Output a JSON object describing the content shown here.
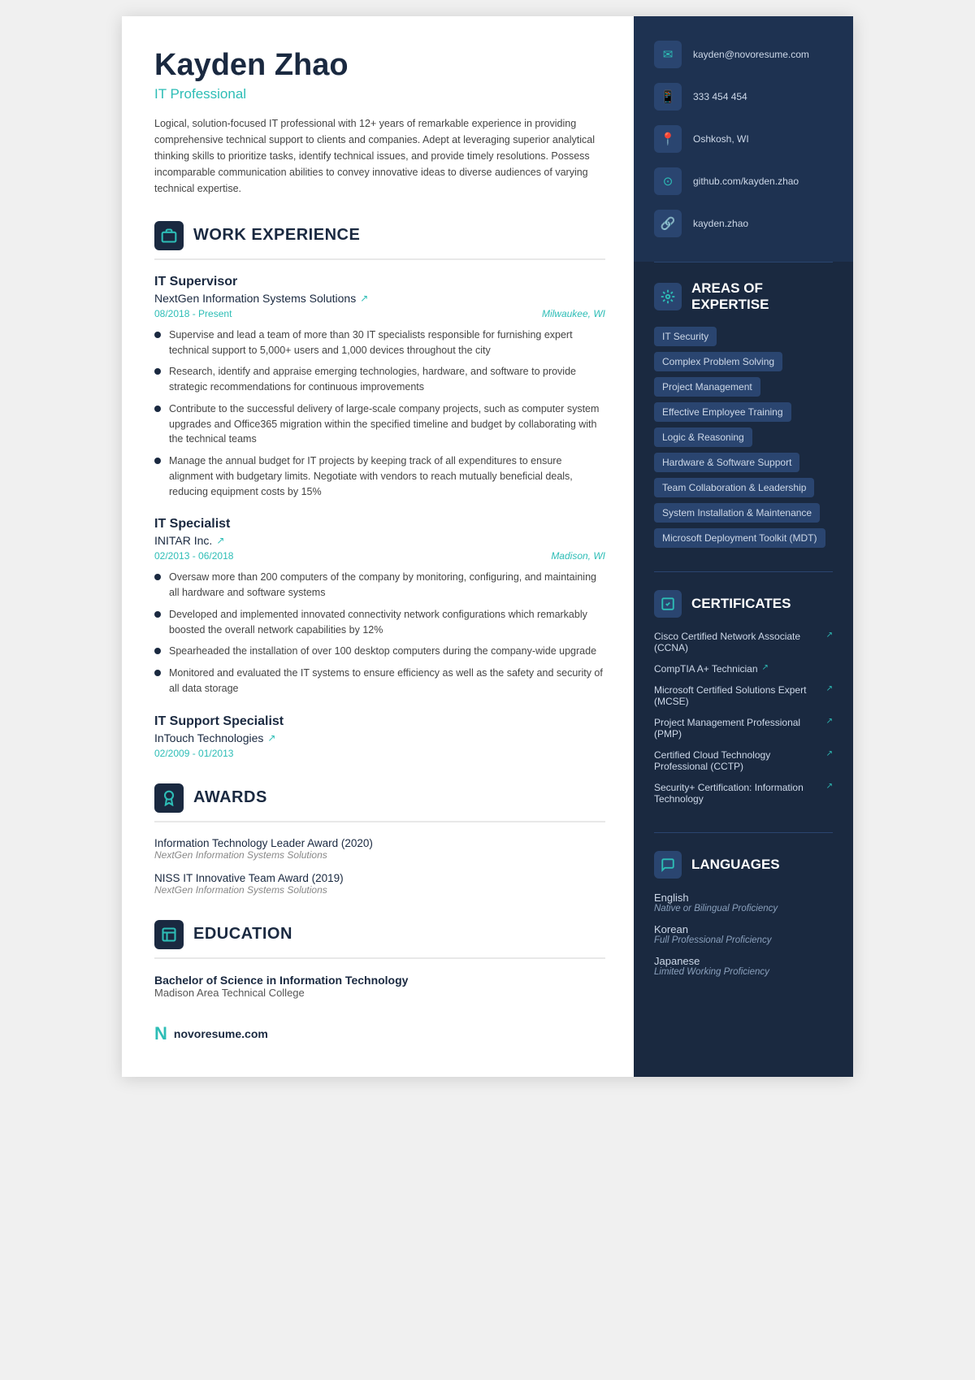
{
  "header": {
    "name": "Kayden Zhao",
    "title": "IT Professional",
    "summary": "Logical, solution-focused IT professional with 12+ years of remarkable experience in providing comprehensive technical support to clients and companies. Adept at leveraging superior analytical thinking skills to prioritize tasks, identify technical issues, and provide timely resolutions. Possess incomparable communication abilities to convey innovative ideas to diverse audiences of varying technical expertise."
  },
  "contact": {
    "email": "kayden@novoresume.com",
    "phone": "333 454 454",
    "location": "Oshkosh, WI",
    "github": "github.com/kayden.zhao",
    "portfolio": "kayden.zhao"
  },
  "sections": {
    "work_experience": "WORK EXPERIENCE",
    "awards": "AWARDS",
    "education": "EDUCATION",
    "areas_of_expertise": "AREAS OF\nEXPERTISE",
    "certificates": "CERTIFICATES",
    "languages": "LANGUAGES"
  },
  "jobs": [
    {
      "title": "IT Supervisor",
      "company": "NextGen Information Systems Solutions",
      "date": "08/2018 - Present",
      "location": "Milwaukee, WI",
      "bullets": [
        "Supervise and lead a team of more than 30 IT specialists responsible for furnishing expert technical support to 5,000+ users and 1,000 devices throughout the city",
        "Research, identify and appraise emerging technologies, hardware, and software to provide strategic recommendations for continuous improvements",
        "Contribute to the successful delivery of large-scale company projects, such as computer system upgrades and Office365 migration within the specified timeline and budget by collaborating with the technical teams",
        "Manage the annual budget for IT projects by keeping track of all expenditures to ensure alignment with budgetary limits. Negotiate with vendors to reach mutually beneficial deals, reducing equipment costs by 15%"
      ]
    },
    {
      "title": "IT Specialist",
      "company": "INITAR Inc.",
      "date": "02/2013 - 06/2018",
      "location": "Madison, WI",
      "bullets": [
        "Oversaw more than 200 computers of the company by monitoring, configuring, and maintaining all hardware and software systems",
        "Developed and implemented innovated connectivity network configurations which remarkably boosted the overall network capabilities by 12%",
        "Spearheaded the installation of over 100 desktop computers during the company-wide upgrade",
        "Monitored and evaluated the IT systems to ensure efficiency as well as the safety and security of all data storage"
      ]
    },
    {
      "title": "IT Support Specialist",
      "company": "InTouch Technologies",
      "date": "02/2009 - 01/2013",
      "location": "",
      "bullets": []
    }
  ],
  "awards": [
    {
      "name": "Information Technology Leader Award (2020)",
      "org": "NextGen Information Systems Solutions"
    },
    {
      "name": "NISS IT Innovative Team Award (2019)",
      "org": "NextGen Information Systems Solutions"
    }
  ],
  "education": {
    "degree": "Bachelor of Science in Information Technology",
    "school": "Madison Area Technical College"
  },
  "skills": [
    "IT Security",
    "Complex Problem Solving",
    "Project Management",
    "Effective Employee Training",
    "Logic & Reasoning",
    "Hardware & Software Support",
    "Team Collaboration & Leadership",
    "System Installation & Maintenance",
    "Microsoft Deployment Toolkit (MDT)"
  ],
  "certificates": [
    "Cisco Certified Network Associate (CCNA)",
    "CompTIA A+ Technician",
    "Microsoft Certified Solutions Expert (MCSE)",
    "Project Management Professional (PMP)",
    "Certified Cloud Technology Professional (CCTP)",
    "Security+ Certification: Information Technology"
  ],
  "languages": [
    {
      "name": "English",
      "level": "Native or Bilingual Proficiency"
    },
    {
      "name": "Korean",
      "level": "Full Professional Proficiency"
    },
    {
      "name": "Japanese",
      "level": "Limited Working Proficiency"
    }
  ],
  "brand": "novoresume.com"
}
